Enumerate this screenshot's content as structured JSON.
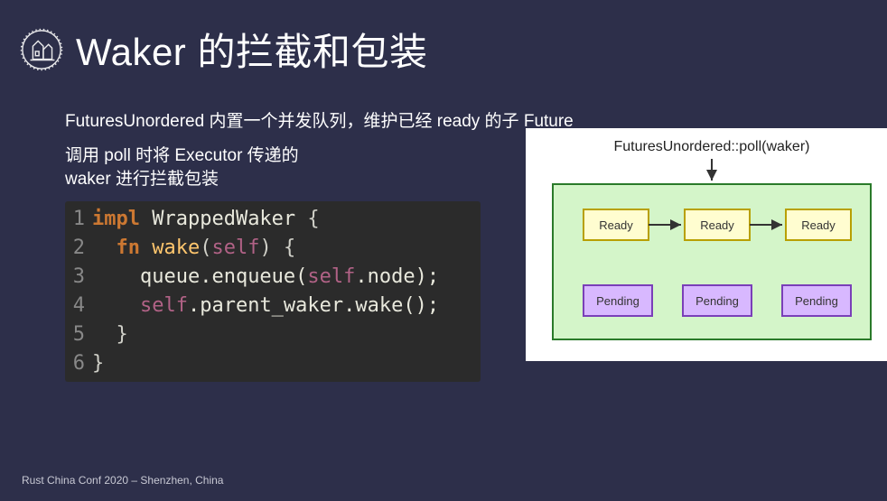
{
  "title": "Waker 的拦截和包装",
  "desc1": "FuturesUnordered 内置一个并发队列，维护已经 ready 的子 Future",
  "desc2_l1": "调用 poll 时将 Executor 传递的",
  "desc2_l2": "waker 进行拦截包装",
  "code": {
    "l1": {
      "no": "1",
      "kw": "impl",
      "ident": " WrappedWaker ",
      "brace": "{"
    },
    "l2": {
      "no": "2",
      "indent": "  ",
      "kw": "fn",
      "name": " wake",
      "lp": "(",
      "self": "self",
      "rp": ") {",
      "brace": ""
    },
    "l3": {
      "no": "3",
      "indent": "    ",
      "a": "queue.enqueue(",
      "self": "self",
      "b": ".node);"
    },
    "l4": {
      "no": "4",
      "indent": "    ",
      "self": "self",
      "a": ".parent_waker.wake();"
    },
    "l5": {
      "no": "5",
      "indent": "  ",
      "brace": "}"
    },
    "l6": {
      "no": "6",
      "brace": "}"
    }
  },
  "diagram": {
    "title": "FuturesUnordered::poll(waker)",
    "ready": "Ready",
    "pending": "Pending"
  },
  "footer": "Rust China Conf 2020 – Shenzhen, China"
}
